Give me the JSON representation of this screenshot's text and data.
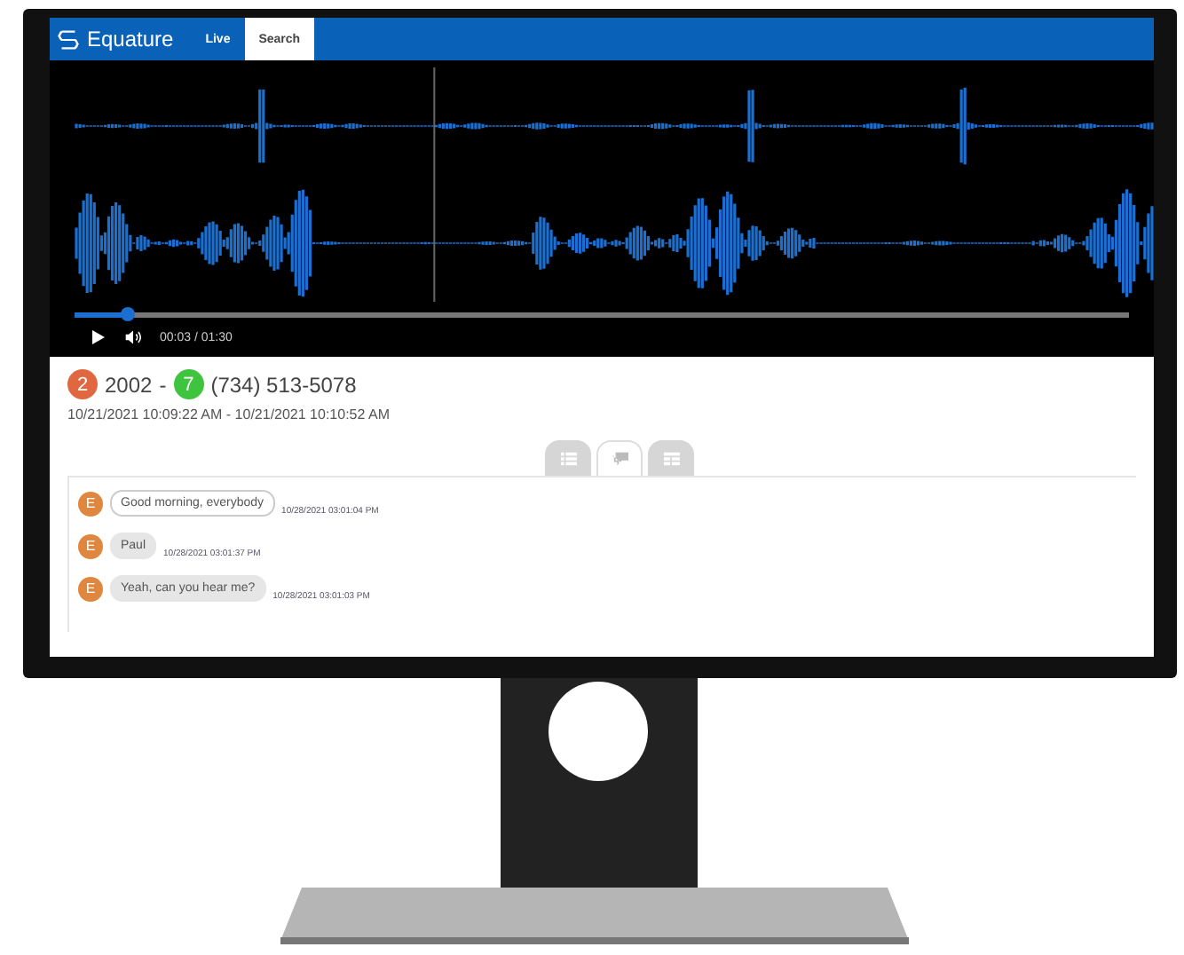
{
  "nav": {
    "brand": "Equature",
    "tabs": [
      {
        "label": "Live",
        "selected": false
      },
      {
        "label": "Search",
        "selected": true
      }
    ]
  },
  "player": {
    "level": 0.05,
    "time": "00:03 / 01:30"
  },
  "call": {
    "parties": [
      {
        "badge": "2",
        "color": "#e0673f",
        "name": "2002"
      },
      {
        "badge": "7",
        "color": "#3fc43f",
        "name": "(734) 513-5078"
      }
    ],
    "separator": "-",
    "range": "10/21/2021 10:09:22 AM - 10/21/2021 10:10:52 AM"
  },
  "view_tabs": [
    {
      "kind": "list",
      "selected": false
    },
    {
      "kind": "chat",
      "selected": true
    },
    {
      "kind": "grid",
      "selected": false
    }
  ],
  "messages": [
    {
      "initial": "E",
      "text": "Good morning, everybody",
      "time": "10/28/2021 03:01:04 PM",
      "selected": true
    },
    {
      "initial": "E",
      "text": "Paul",
      "time": "10/28/2021 03:01:37 PM",
      "selected": false
    },
    {
      "initial": "E",
      "text": "Yeah, can you hear me?",
      "time": "10/28/2021 03:01:03 PM",
      "selected": false
    }
  ]
}
